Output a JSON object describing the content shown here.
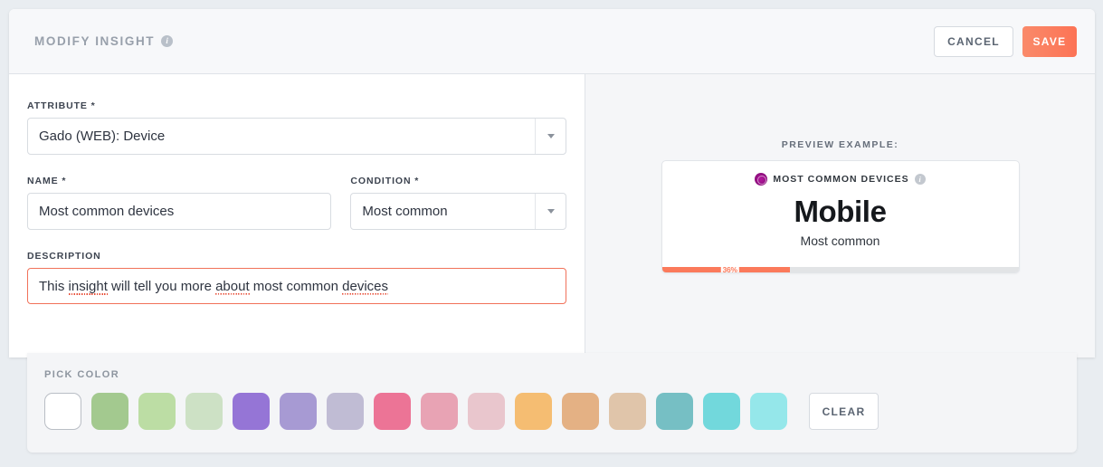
{
  "header": {
    "title": "MODIFY INSIGHT",
    "info_icon": "info-icon",
    "cancel_label": "CANCEL",
    "save_label": "SAVE",
    "save_color": "#fb7a5b"
  },
  "form": {
    "attribute": {
      "label": "ATTRIBUTE *",
      "value": "Gado (WEB): Device"
    },
    "name": {
      "label": "NAME *",
      "value": "Most common devices"
    },
    "condition": {
      "label": "CONDITION *",
      "value": "Most common"
    },
    "description": {
      "label": "DESCRIPTION",
      "value": "This insight will tell you more about most common devices",
      "parts": [
        {
          "text": "This ",
          "misspelled": false
        },
        {
          "text": "insight",
          "misspelled": true
        },
        {
          "text": " will tell you more ",
          "misspelled": false
        },
        {
          "text": "about",
          "misspelled": true
        },
        {
          "text": " most common ",
          "misspelled": false
        },
        {
          "text": "devices",
          "misspelled": true
        }
      ],
      "border_color": "#f1725a"
    }
  },
  "preview": {
    "label": "PREVIEW EXAMPLE:",
    "card": {
      "badge_color": "#8d0f7d",
      "title": "MOST COMMON DEVICES",
      "info_icon": "info-icon",
      "value": "Mobile",
      "subtitle": "Most common",
      "percent_label": "36%",
      "percent_value": 36,
      "bar_color": "#fb7a5b"
    }
  },
  "pick_color": {
    "label": "PICK COLOR",
    "clear_label": "CLEAR",
    "swatches": [
      {
        "name": "white",
        "hex": "#ffffff"
      },
      {
        "name": "green-dark",
        "hex": "#a3c98f"
      },
      {
        "name": "green-mid",
        "hex": "#bcdda4"
      },
      {
        "name": "green-light",
        "hex": "#cde1c5"
      },
      {
        "name": "purple-dark",
        "hex": "#9575d6"
      },
      {
        "name": "purple-mid",
        "hex": "#a79ad3"
      },
      {
        "name": "purple-light",
        "hex": "#c0bcd4"
      },
      {
        "name": "pink-dark",
        "hex": "#ec7496"
      },
      {
        "name": "pink-mid",
        "hex": "#e8a3b4"
      },
      {
        "name": "pink-light",
        "hex": "#e9c6cd"
      },
      {
        "name": "orange-dark",
        "hex": "#f5bd72"
      },
      {
        "name": "orange-mid",
        "hex": "#e4b184"
      },
      {
        "name": "orange-light",
        "hex": "#e0c5aa"
      },
      {
        "name": "teal-dark",
        "hex": "#76bfc4"
      },
      {
        "name": "teal-mid",
        "hex": "#72d8dc"
      },
      {
        "name": "teal-light",
        "hex": "#95e7ea"
      }
    ]
  }
}
